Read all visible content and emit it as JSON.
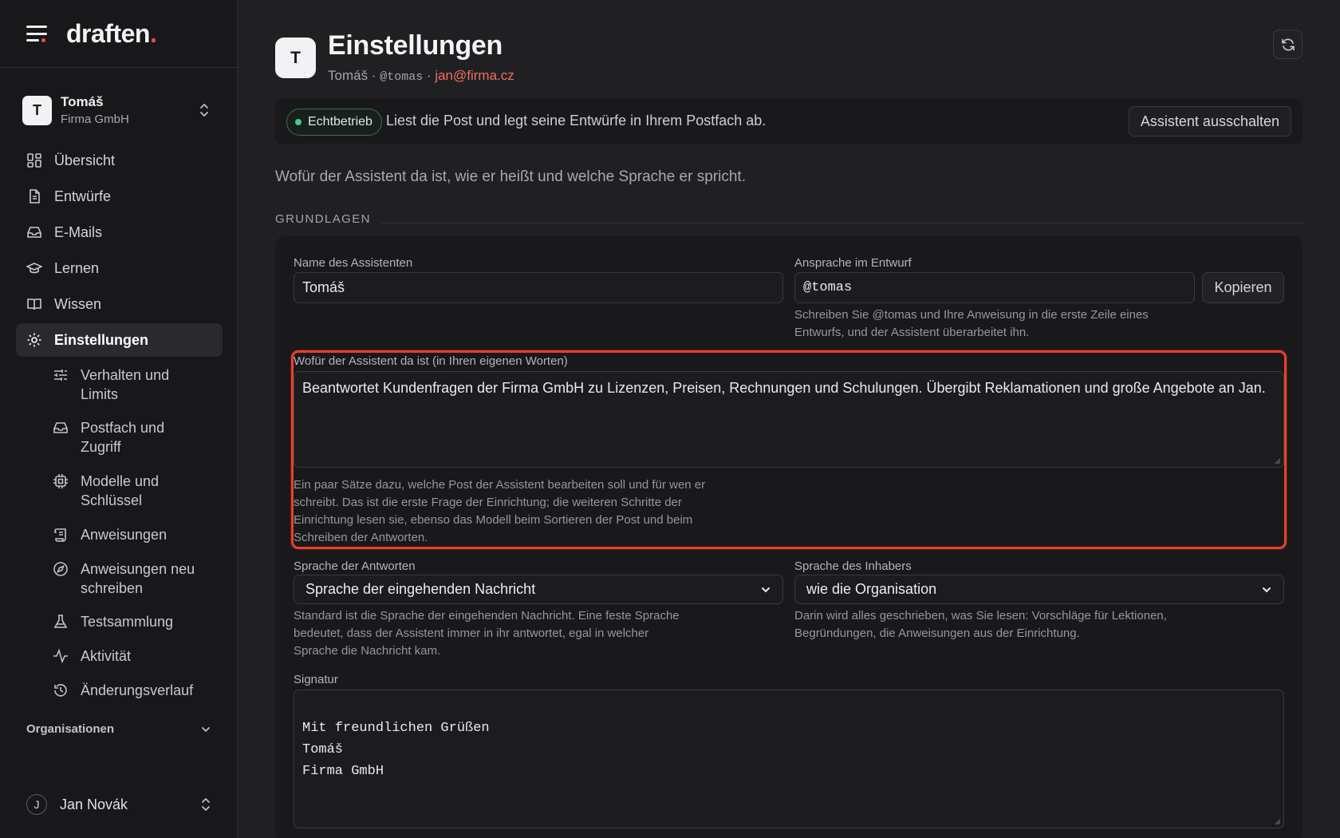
{
  "brand": {
    "name": "draften",
    "dot": "."
  },
  "workspace": {
    "initial": "T",
    "name": "Tomáš",
    "org": "Firma GmbH"
  },
  "nav": [
    {
      "label": "Übersicht",
      "icon": "dashboard-icon"
    },
    {
      "label": "Entwürfe",
      "icon": "file-icon"
    },
    {
      "label": "E-Mails",
      "icon": "inbox-icon"
    },
    {
      "label": "Lernen",
      "icon": "graduation-icon"
    },
    {
      "label": "Wissen",
      "icon": "book-icon"
    },
    {
      "label": "Einstellungen",
      "icon": "gear-icon",
      "active": true
    }
  ],
  "subnav": [
    {
      "label": "Verhalten und Limits",
      "icon": "sliders-icon"
    },
    {
      "label": "Postfach und Zugriff",
      "icon": "inbox-icon"
    },
    {
      "label": "Modelle und Schlüssel",
      "icon": "cpu-icon"
    },
    {
      "label": "Anweisungen",
      "icon": "scroll-icon"
    },
    {
      "label": "Anweisungen neu schreiben",
      "icon": "compass-icon"
    },
    {
      "label": "Testsammlung",
      "icon": "flask-icon"
    },
    {
      "label": "Aktivität",
      "icon": "activity-icon"
    },
    {
      "label": "Änderungsverlauf",
      "icon": "history-icon"
    }
  ],
  "org_section": "Organisationen",
  "user": {
    "initial": "J",
    "name": "Jan Novák"
  },
  "header": {
    "initial": "T",
    "title": "Einstellungen",
    "name": "Tomáš",
    "sep1": " · ",
    "handle": "@tomas",
    "sep2": " · ",
    "email": "jan@firma.cz"
  },
  "status": {
    "badge": "Echtbetrieb",
    "text": "Liest die Post und legt seine Entwürfe in Ihrem Postfach ab.",
    "button": "Assistent ausschalten"
  },
  "intro": "Wofür der Assistent da ist, wie er heißt und welche Sprache er spricht.",
  "section": "GRUNDLAGEN",
  "form": {
    "name_label": "Name des Assistenten",
    "name_value": "Tomáš",
    "address_label": "Ansprache im Entwurf",
    "address_value": "@tomas",
    "copy_button": "Kopieren",
    "address_help": "Schreiben Sie @tomas und Ihre Anweisung in die erste Zeile eines Entwurfs, und der Assistent überarbeitet ihn.",
    "purpose_label": "Wofür der Assistent da ist (in Ihren eigenen Worten)",
    "purpose_value": "Beantwortet Kundenfragen der Firma GmbH zu Lizenzen, Preisen, Rechnungen und Schulungen. Übergibt Reklamationen und große Angebote an Jan.",
    "purpose_help": "Ein paar Sätze dazu, welche Post der Assistent bearbeiten soll und für wen er schreibt. Das ist die erste Frage der Einrichtung; die weiteren Schritte der Einrichtung lesen sie, ebenso das Modell beim Sortieren der Post und beim Schreiben der Antworten.",
    "reply_lang_label": "Sprache der Antworten",
    "reply_lang_value": "Sprache der eingehenden Nachricht",
    "reply_lang_help": "Standard ist die Sprache der eingehenden Nachricht. Eine feste Sprache bedeutet, dass der Assistent immer in ihr antwortet, egal in welcher Sprache die Nachricht kam.",
    "owner_lang_label": "Sprache des Inhabers",
    "owner_lang_value": "wie die Organisation",
    "owner_lang_help": "Darin wird alles geschrieben, was Sie lesen: Vorschläge für Lektionen, Begründungen, die Anweisungen aus der Einrichtung.",
    "signature_label": "Signatur",
    "signature_value": "Mit freundlichen Grüßen\nTomáš\nFirma GmbH"
  },
  "colors": {
    "accent": "#ef4b3d",
    "status_green": "#3fcf85",
    "email": "#ee6f5e",
    "highlight": "#ee3d2f"
  }
}
